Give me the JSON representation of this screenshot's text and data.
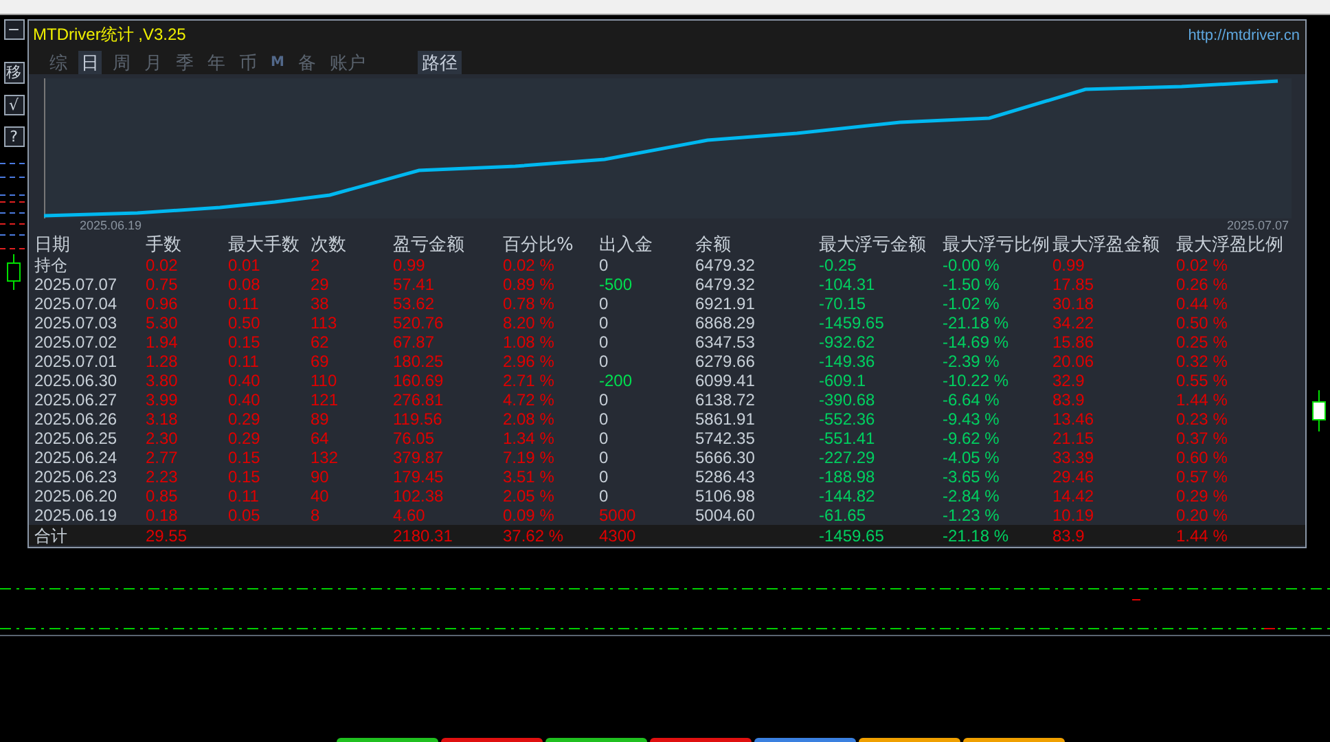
{
  "side_buttons": [
    "−",
    "移",
    "√",
    "?"
  ],
  "window": {
    "title": "MTDriver统计 ,V3.25",
    "link": "http://mtdriver.cn"
  },
  "tabs": [
    {
      "label": "综",
      "selected": false,
      "kind": "text"
    },
    {
      "label": "日",
      "selected": true,
      "kind": "text"
    },
    {
      "label": "周",
      "selected": false,
      "kind": "text"
    },
    {
      "label": "月",
      "selected": false,
      "kind": "text"
    },
    {
      "label": "季",
      "selected": false,
      "kind": "text"
    },
    {
      "label": "年",
      "selected": false,
      "kind": "text"
    },
    {
      "label": "币",
      "selected": false,
      "kind": "text"
    },
    {
      "label": "M",
      "selected": false,
      "kind": "small"
    },
    {
      "label": "备",
      "selected": false,
      "kind": "text"
    },
    {
      "label": "账户",
      "selected": false,
      "kind": "text"
    }
  ],
  "path_button": "路径",
  "chart": {
    "start_label": "2025.06.19",
    "end_label": "2025.07.07"
  },
  "table": {
    "columns": [
      "日期",
      "手数",
      "最大手数",
      "次数",
      "盈亏金额",
      "百分比%",
      "出入金",
      "余额",
      "最大浮亏金额",
      "最大浮亏比例",
      "最大浮盈金额",
      "最大浮盈比例"
    ],
    "rows": [
      {
        "cells": [
          {
            "text": "持仓",
            "color": "#c8d0d8"
          },
          {
            "text": "0.02",
            "color": "#e00000"
          },
          {
            "text": "0.01",
            "color": "#e00000"
          },
          {
            "text": "2",
            "color": "#e00000"
          },
          {
            "text": "0.99",
            "color": "#e00000"
          },
          {
            "text": "0.02 %",
            "color": "#e00000"
          },
          {
            "text": "0",
            "color": "#c8d0d8"
          },
          {
            "text": "6479.32",
            "color": "#c8d0d8"
          },
          {
            "text": "-0.25",
            "color": "#00d060"
          },
          {
            "text": "-0.00 %",
            "color": "#00d060"
          },
          {
            "text": "0.99",
            "color": "#e00000"
          },
          {
            "text": "0.02 %",
            "color": "#e00000"
          }
        ]
      },
      {
        "cells": [
          {
            "text": "2025.07.07",
            "color": "#c8d0d8"
          },
          {
            "text": "0.75",
            "color": "#e00000"
          },
          {
            "text": "0.08",
            "color": "#e00000"
          },
          {
            "text": "29",
            "color": "#e00000"
          },
          {
            "text": "57.41",
            "color": "#e00000"
          },
          {
            "text": "0.89 %",
            "color": "#e00000"
          },
          {
            "text": "-500",
            "color": "#00e050"
          },
          {
            "text": "6479.32",
            "color": "#c8d0d8"
          },
          {
            "text": "-104.31",
            "color": "#00d060"
          },
          {
            "text": "-1.50 %",
            "color": "#00d060"
          },
          {
            "text": "17.85",
            "color": "#e00000"
          },
          {
            "text": "0.26 %",
            "color": "#e00000"
          }
        ]
      },
      {
        "cells": [
          {
            "text": "2025.07.04",
            "color": "#c8d0d8"
          },
          {
            "text": "0.96",
            "color": "#e00000"
          },
          {
            "text": "0.11",
            "color": "#e00000"
          },
          {
            "text": "38",
            "color": "#e00000"
          },
          {
            "text": "53.62",
            "color": "#e00000"
          },
          {
            "text": "0.78 %",
            "color": "#e00000"
          },
          {
            "text": "0",
            "color": "#c8d0d8"
          },
          {
            "text": "6921.91",
            "color": "#c8d0d8"
          },
          {
            "text": "-70.15",
            "color": "#00d060"
          },
          {
            "text": "-1.02 %",
            "color": "#00d060"
          },
          {
            "text": "30.18",
            "color": "#e00000"
          },
          {
            "text": "0.44 %",
            "color": "#e00000"
          }
        ]
      },
      {
        "cells": [
          {
            "text": "2025.07.03",
            "color": "#c8d0d8"
          },
          {
            "text": "5.30",
            "color": "#e00000"
          },
          {
            "text": "0.50",
            "color": "#e00000"
          },
          {
            "text": "113",
            "color": "#e00000"
          },
          {
            "text": "520.76",
            "color": "#e00000"
          },
          {
            "text": "8.20 %",
            "color": "#e00000"
          },
          {
            "text": "0",
            "color": "#c8d0d8"
          },
          {
            "text": "6868.29",
            "color": "#c8d0d8"
          },
          {
            "text": "-1459.65",
            "color": "#00d060"
          },
          {
            "text": "-21.18 %",
            "color": "#00d060"
          },
          {
            "text": "34.22",
            "color": "#e00000"
          },
          {
            "text": "0.50 %",
            "color": "#e00000"
          }
        ]
      },
      {
        "cells": [
          {
            "text": "2025.07.02",
            "color": "#c8d0d8"
          },
          {
            "text": "1.94",
            "color": "#e00000"
          },
          {
            "text": "0.15",
            "color": "#e00000"
          },
          {
            "text": "62",
            "color": "#e00000"
          },
          {
            "text": "67.87",
            "color": "#e00000"
          },
          {
            "text": "1.08 %",
            "color": "#e00000"
          },
          {
            "text": "0",
            "color": "#c8d0d8"
          },
          {
            "text": "6347.53",
            "color": "#c8d0d8"
          },
          {
            "text": "-932.62",
            "color": "#00d060"
          },
          {
            "text": "-14.69 %",
            "color": "#00d060"
          },
          {
            "text": "15.86",
            "color": "#e00000"
          },
          {
            "text": "0.25 %",
            "color": "#e00000"
          }
        ]
      },
      {
        "cells": [
          {
            "text": "2025.07.01",
            "color": "#c8d0d8"
          },
          {
            "text": "1.28",
            "color": "#e00000"
          },
          {
            "text": "0.11",
            "color": "#e00000"
          },
          {
            "text": "69",
            "color": "#e00000"
          },
          {
            "text": "180.25",
            "color": "#e00000"
          },
          {
            "text": "2.96 %",
            "color": "#e00000"
          },
          {
            "text": "0",
            "color": "#c8d0d8"
          },
          {
            "text": "6279.66",
            "color": "#c8d0d8"
          },
          {
            "text": "-149.36",
            "color": "#00d060"
          },
          {
            "text": "-2.39 %",
            "color": "#00d060"
          },
          {
            "text": "20.06",
            "color": "#e00000"
          },
          {
            "text": "0.32 %",
            "color": "#e00000"
          }
        ]
      },
      {
        "cells": [
          {
            "text": "2025.06.30",
            "color": "#c8d0d8"
          },
          {
            "text": "3.80",
            "color": "#e00000"
          },
          {
            "text": "0.40",
            "color": "#e00000"
          },
          {
            "text": "110",
            "color": "#e00000"
          },
          {
            "text": "160.69",
            "color": "#e00000"
          },
          {
            "text": "2.71 %",
            "color": "#e00000"
          },
          {
            "text": "-200",
            "color": "#00e050"
          },
          {
            "text": "6099.41",
            "color": "#c8d0d8"
          },
          {
            "text": "-609.1",
            "color": "#00d060"
          },
          {
            "text": "-10.22 %",
            "color": "#00d060"
          },
          {
            "text": "32.9",
            "color": "#e00000"
          },
          {
            "text": "0.55 %",
            "color": "#e00000"
          }
        ]
      },
      {
        "cells": [
          {
            "text": "2025.06.27",
            "color": "#c8d0d8"
          },
          {
            "text": "3.99",
            "color": "#e00000"
          },
          {
            "text": "0.40",
            "color": "#e00000"
          },
          {
            "text": "121",
            "color": "#e00000"
          },
          {
            "text": "276.81",
            "color": "#e00000"
          },
          {
            "text": "4.72 %",
            "color": "#e00000"
          },
          {
            "text": "0",
            "color": "#c8d0d8"
          },
          {
            "text": "6138.72",
            "color": "#c8d0d8"
          },
          {
            "text": "-390.68",
            "color": "#00d060"
          },
          {
            "text": "-6.64 %",
            "color": "#00d060"
          },
          {
            "text": "83.9",
            "color": "#e00000"
          },
          {
            "text": "1.44 %",
            "color": "#e00000"
          }
        ]
      },
      {
        "cells": [
          {
            "text": "2025.06.26",
            "color": "#c8d0d8"
          },
          {
            "text": "3.18",
            "color": "#e00000"
          },
          {
            "text": "0.29",
            "color": "#e00000"
          },
          {
            "text": "89",
            "color": "#e00000"
          },
          {
            "text": "119.56",
            "color": "#e00000"
          },
          {
            "text": "2.08 %",
            "color": "#e00000"
          },
          {
            "text": "0",
            "color": "#c8d0d8"
          },
          {
            "text": "5861.91",
            "color": "#c8d0d8"
          },
          {
            "text": "-552.36",
            "color": "#00d060"
          },
          {
            "text": "-9.43 %",
            "color": "#00d060"
          },
          {
            "text": "13.46",
            "color": "#e00000"
          },
          {
            "text": "0.23 %",
            "color": "#e00000"
          }
        ]
      },
      {
        "cells": [
          {
            "text": "2025.06.25",
            "color": "#c8d0d8"
          },
          {
            "text": "2.30",
            "color": "#e00000"
          },
          {
            "text": "0.29",
            "color": "#e00000"
          },
          {
            "text": "64",
            "color": "#e00000"
          },
          {
            "text": "76.05",
            "color": "#e00000"
          },
          {
            "text": "1.34 %",
            "color": "#e00000"
          },
          {
            "text": "0",
            "color": "#c8d0d8"
          },
          {
            "text": "5742.35",
            "color": "#c8d0d8"
          },
          {
            "text": "-551.41",
            "color": "#00d060"
          },
          {
            "text": "-9.62 %",
            "color": "#00d060"
          },
          {
            "text": "21.15",
            "color": "#e00000"
          },
          {
            "text": "0.37 %",
            "color": "#e00000"
          }
        ]
      },
      {
        "cells": [
          {
            "text": "2025.06.24",
            "color": "#c8d0d8"
          },
          {
            "text": "2.77",
            "color": "#e00000"
          },
          {
            "text": "0.15",
            "color": "#e00000"
          },
          {
            "text": "132",
            "color": "#e00000"
          },
          {
            "text": "379.87",
            "color": "#e00000"
          },
          {
            "text": "7.19 %",
            "color": "#e00000"
          },
          {
            "text": "0",
            "color": "#c8d0d8"
          },
          {
            "text": "5666.30",
            "color": "#c8d0d8"
          },
          {
            "text": "-227.29",
            "color": "#00d060"
          },
          {
            "text": "-4.05 %",
            "color": "#00d060"
          },
          {
            "text": "33.39",
            "color": "#e00000"
          },
          {
            "text": "0.60 %",
            "color": "#e00000"
          }
        ]
      },
      {
        "cells": [
          {
            "text": "2025.06.23",
            "color": "#c8d0d8"
          },
          {
            "text": "2.23",
            "color": "#e00000"
          },
          {
            "text": "0.15",
            "color": "#e00000"
          },
          {
            "text": "90",
            "color": "#e00000"
          },
          {
            "text": "179.45",
            "color": "#e00000"
          },
          {
            "text": "3.51 %",
            "color": "#e00000"
          },
          {
            "text": "0",
            "color": "#c8d0d8"
          },
          {
            "text": "5286.43",
            "color": "#c8d0d8"
          },
          {
            "text": "-188.98",
            "color": "#00d060"
          },
          {
            "text": "-3.65 %",
            "color": "#00d060"
          },
          {
            "text": "29.46",
            "color": "#e00000"
          },
          {
            "text": "0.57 %",
            "color": "#e00000"
          }
        ]
      },
      {
        "cells": [
          {
            "text": "2025.06.20",
            "color": "#c8d0d8"
          },
          {
            "text": "0.85",
            "color": "#e00000"
          },
          {
            "text": "0.11",
            "color": "#e00000"
          },
          {
            "text": "40",
            "color": "#e00000"
          },
          {
            "text": "102.38",
            "color": "#e00000"
          },
          {
            "text": "2.05 %",
            "color": "#e00000"
          },
          {
            "text": "0",
            "color": "#c8d0d8"
          },
          {
            "text": "5106.98",
            "color": "#c8d0d8"
          },
          {
            "text": "-144.82",
            "color": "#00d060"
          },
          {
            "text": "-2.84 %",
            "color": "#00d060"
          },
          {
            "text": "14.42",
            "color": "#e00000"
          },
          {
            "text": "0.29 %",
            "color": "#e00000"
          }
        ]
      },
      {
        "cells": [
          {
            "text": "2025.06.19",
            "color": "#c8d0d8"
          },
          {
            "text": "0.18",
            "color": "#e00000"
          },
          {
            "text": "0.05",
            "color": "#e00000"
          },
          {
            "text": "8",
            "color": "#e00000"
          },
          {
            "text": "4.60",
            "color": "#e00000"
          },
          {
            "text": "0.09 %",
            "color": "#e00000"
          },
          {
            "text": "5000",
            "color": "#e00000"
          },
          {
            "text": "5004.60",
            "color": "#c8d0d8"
          },
          {
            "text": "-61.65",
            "color": "#00d060"
          },
          {
            "text": "-1.23 %",
            "color": "#00d060"
          },
          {
            "text": "10.19",
            "color": "#e00000"
          },
          {
            "text": "0.20 %",
            "color": "#e00000"
          }
        ]
      }
    ],
    "total": {
      "cells": [
        {
          "text": "合计",
          "color": "#c8d0d8"
        },
        {
          "text": "29.55",
          "color": "#e00000"
        },
        null,
        null,
        {
          "text": "2180.31",
          "color": "#e00000"
        },
        {
          "text": "37.62 %",
          "color": "#e00000"
        },
        {
          "text": "4300",
          "color": "#e00000"
        },
        null,
        {
          "text": "-1459.65",
          "color": "#00d060"
        },
        {
          "text": "-21.18 %",
          "color": "#00d060"
        },
        {
          "text": "83.9",
          "color": "#e00000"
        },
        {
          "text": "1.44 %",
          "color": "#e00000"
        }
      ]
    }
  }
}
